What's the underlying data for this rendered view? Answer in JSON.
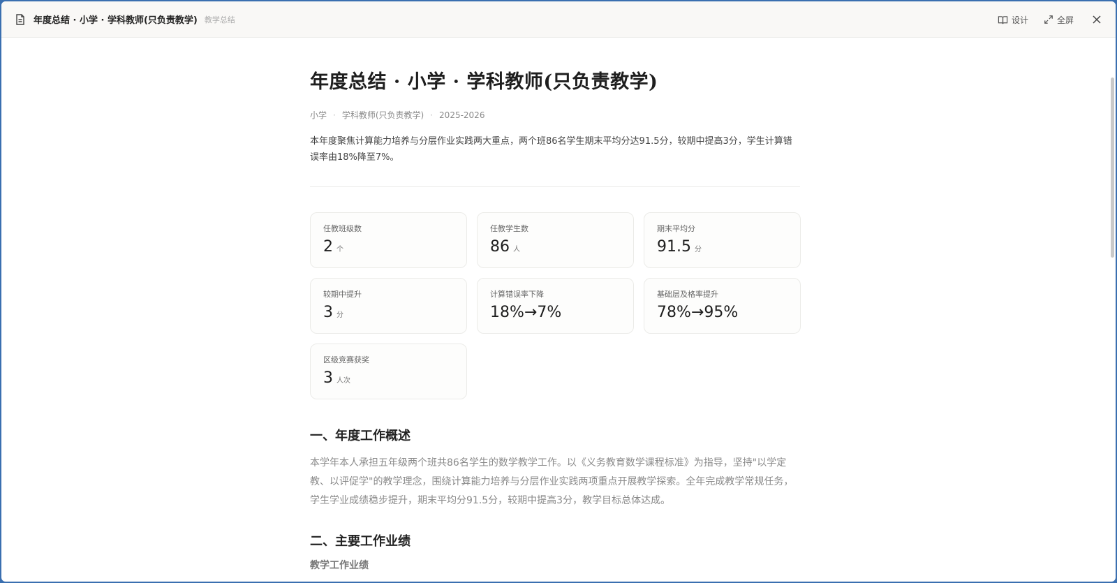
{
  "window": {
    "title": "年度总结 · 小学 · 学科教师(只负责教学)",
    "subtitle": "教学总结",
    "actions": {
      "design": "设计",
      "fullscreen": "全屏"
    }
  },
  "doc": {
    "title": "年度总结 · 小学 · 学科教师(只负责教学)",
    "meta": [
      "小学",
      "学科教师(只负责教学)",
      "2025-2026"
    ],
    "summary": "本年度聚焦计算能力培养与分层作业实践两大重点，两个班86名学生期末平均分达91.5分，较期中提高3分，学生计算错误率由18%降至7%。",
    "stats": [
      {
        "label": "任教班级数",
        "value": "2",
        "unit": "个"
      },
      {
        "label": "任教学生数",
        "value": "86",
        "unit": "人"
      },
      {
        "label": "期末平均分",
        "value": "91.5",
        "unit": "分"
      },
      {
        "label": "较期中提升",
        "value": "3",
        "unit": "分"
      },
      {
        "label": "计算错误率下降",
        "value": "18%→7%",
        "unit": ""
      },
      {
        "label": "基础层及格率提升",
        "value": "78%→95%",
        "unit": ""
      },
      {
        "label": "区级竞赛获奖",
        "value": "3",
        "unit": "人次"
      }
    ],
    "section1": {
      "heading": "一、年度工作概述",
      "paragraph": "本学年本人承担五年级两个班共86名学生的数学教学工作。以《义务教育数学课程标准》为指导，坚持\"以学定教、以评促学\"的教学理念，围绕计算能力培养与分层作业实践两项重点开展教学探索。全年完成教学常规任务，学生学业成绩稳步提升，期末平均分91.5分，较期中提高3分，教学目标总体达成。"
    },
    "section2": {
      "heading": "二、主要工作业绩",
      "subheading": "教学工作业绩"
    }
  },
  "icons": {
    "doc": "document-icon",
    "design": "book-open-icon",
    "fullscreen": "expand-icon",
    "close": "close-icon"
  }
}
